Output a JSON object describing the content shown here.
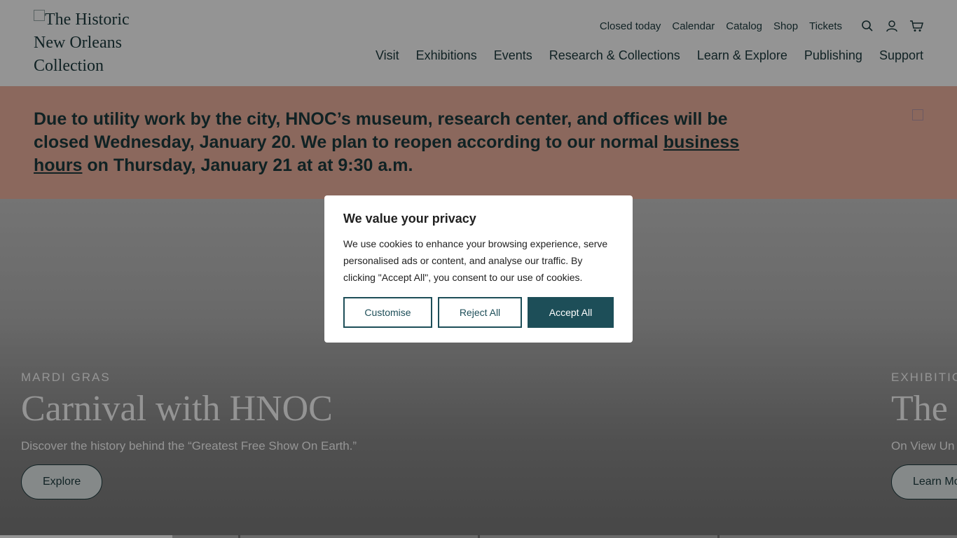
{
  "header": {
    "logo_alt": "The Historic New Orleans Collection",
    "utility_links": [
      "Closed today",
      "Calendar",
      "Catalog",
      "Shop",
      "Tickets"
    ],
    "icons": [
      "search-icon",
      "user-icon",
      "cart-icon"
    ],
    "main_nav": [
      "Visit",
      "Exhibitions",
      "Events",
      "Research & Collections",
      "Learn & Explore",
      "Publishing",
      "Support"
    ]
  },
  "alert": {
    "text_before": "Due to utility work by the city, HNOC’s museum, research center, and offices will be closed Wednesday, January 20. We plan to reopen according to our normal ",
    "link": "business hours",
    "text_after": " on Thursday, January 21 at at 9:30 a.m."
  },
  "hero": {
    "slides": [
      {
        "kicker": "MARDI GRAS",
        "title": "Carnival with HNOC",
        "description": "Discover the history behind the “Greatest Free Show On Earth.”",
        "button": "Explore"
      },
      {
        "kicker": "EXHIBITIO",
        "title": "The",
        "description": "On View Un",
        "button": "Learn Mo"
      }
    ],
    "progress": 0.18
  },
  "cookie_modal": {
    "title": "We value your privacy",
    "body": "We use cookies to enhance your browsing experience, serve personalised ads or content, and analyse our traffic. By clicking \"Accept All\", you consent to our use of cookies.",
    "customise_label": "Customise",
    "reject_label": "Reject All",
    "accept_label": "Accept All"
  },
  "colors": {
    "brand_dark": "#1d3b3f",
    "alert_bg": "#f0b4a0",
    "accept_bg": "#1d4e58",
    "overlay": "rgba(0,0,0,0.42)"
  }
}
